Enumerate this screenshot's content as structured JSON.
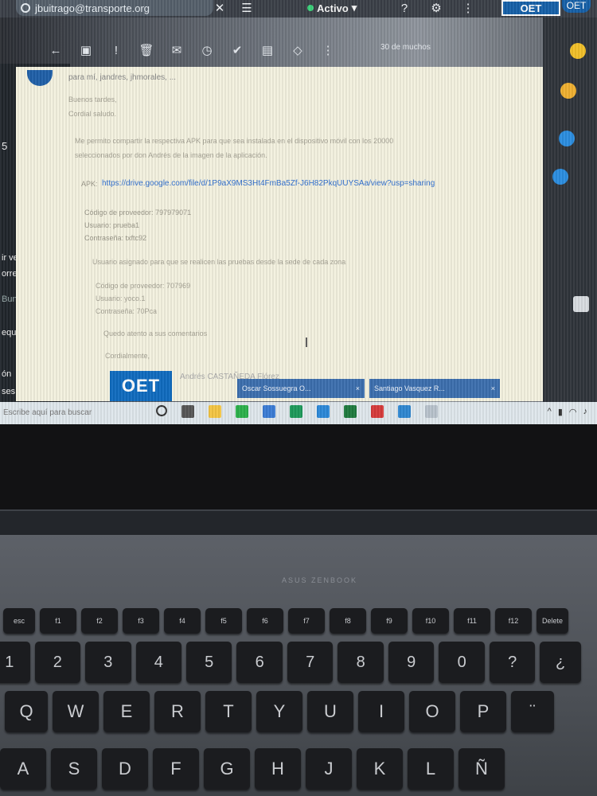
{
  "top": {
    "search_text": "jbuitrago@transporte.org",
    "status": "Activo"
  },
  "toolbar": {
    "page_count": "30 de muchos"
  },
  "left_panel": {
    "items": [
      "5",
      "ir vel...",
      "orres",
      "Bunsta...",
      "equerimi...",
      "ón",
      "ses"
    ]
  },
  "email": {
    "from": "para mí, jandres, jhmorales, ...",
    "greeting": "Buenos tardes,",
    "greeting2": "Cordial saludo.",
    "body1": "Me permito compartir la respectiva APK para que sea instalada en el dispositivo móvil con los 20000",
    "body2": "seleccionados por don Andrés de la imagen de la aplicación.",
    "apk_label": "APK:",
    "apk_link": "https://drive.google.com/file/d/1P9aX9MS3Ht4FmBa5Zf-J6H82PkqUUYSAa/view?usp=sharing",
    "cred1_code": "Código de proveedor: 797979071",
    "cred1_user": "Usuario: prueba1",
    "cred1_pass": "Contraseña: txftc92",
    "body3": "Usuario asignado para que se realicen las pruebas desde la sede de cada zona",
    "cred2_code": "Código de proveedor: 707969",
    "cred2_user": "Usuario: yoco.1",
    "cred2_pass": "Contraseña: 70Pca",
    "closing_hint": "Quedo atento a sus comentarios",
    "closing": "Cordialmente,",
    "signature_name": "Andrés CASTAÑEDA Flórez",
    "signature_logo": "OET"
  },
  "chat_chips": [
    {
      "label": "Oscar Sossuegra O...",
      "close": "×"
    },
    {
      "label": "Santiago Vasquez R...",
      "close": "×"
    }
  ],
  "taskbar": {
    "search_placeholder": "Escribe aquí para buscar"
  },
  "brand": "ASUS ZENBOOK",
  "keyboard": {
    "fn_row": [
      "f1",
      "f2",
      "f3",
      "f4",
      "f5",
      "f6",
      "f7",
      "f8",
      "f9",
      "f10",
      "f11",
      "f12",
      "Delete"
    ],
    "num_row": [
      "1",
      "2",
      "3",
      "4",
      "5",
      "6",
      "7",
      "8",
      "9",
      "0",
      "?",
      "¿"
    ],
    "qwe_row": [
      "Q",
      "W",
      "E",
      "R",
      "T",
      "Y",
      "U",
      "I",
      "O",
      "P",
      "¨"
    ],
    "asd_row": [
      "A",
      "S",
      "D",
      "F",
      "G",
      "H",
      "J",
      "K",
      "L",
      "Ñ"
    ]
  }
}
